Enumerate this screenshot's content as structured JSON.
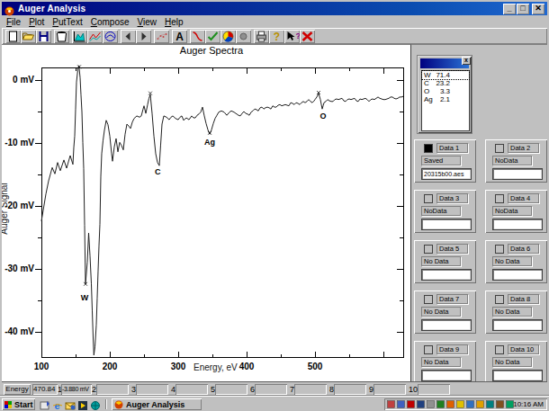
{
  "window": {
    "title": "Auger Analysis"
  },
  "menu": [
    "File",
    "Plot",
    "PutText",
    "Compose",
    "View",
    "Help"
  ],
  "toolbar_icons": [
    "new-document",
    "open-folder",
    "save-disk",
    "bucket",
    "area-chart",
    "line-chart",
    "circle-curve",
    "arrow-left",
    "arrow-right",
    "scatter-points",
    "text-a",
    "red-curve",
    "check-mark",
    "pie-chart",
    "gray-dot",
    "printer",
    "help-question",
    "context-help",
    "close-x"
  ],
  "chart_data": {
    "type": "line",
    "title": "Auger Spectra",
    "xlabel": "Energy, eV",
    "ylabel": "Auger Signal",
    "xlim": [
      100,
      629
    ],
    "ylim": [
      -44.1,
      2
    ],
    "x_ticks_major": [
      100,
      200,
      300,
      400,
      500,
      600
    ],
    "x_ticks_minor": [
      150,
      250,
      350,
      450,
      550
    ],
    "x_tick_labels": [
      "100",
      "200",
      "300",
      "400",
      "500"
    ],
    "y_ticks_major": [
      0,
      -10,
      -20,
      -30,
      -40
    ],
    "y_ticks_minor": [
      -5,
      -15,
      -25,
      -35
    ],
    "y_tick_labels": [
      "0 mV",
      "-10 mV",
      "-20 mV",
      "-30 mV",
      "-40 mV"
    ],
    "annotations": [
      {
        "text": "W",
        "ev": 163,
        "mv": -34.6
      },
      {
        "text": "C",
        "ev": 270,
        "mv": -14.6
      },
      {
        "text": "Ag",
        "ev": 346,
        "mv": -9.8
      },
      {
        "text": "O",
        "ev": 512,
        "mv": -5.7
      }
    ],
    "markers": [
      {
        "ev": 155.3,
        "mv": 2.1
      },
      {
        "ev": 164.5,
        "mv": -32.4
      },
      {
        "ev": 259.2,
        "mv": -2.1
      },
      {
        "ev": 346.1,
        "mv": -8.4
      },
      {
        "ev": 505.3,
        "mv": -2
      }
    ],
    "series": [
      {
        "name": "spectrum",
        "points": [
          [
            100,
            -22.4
          ],
          [
            102.6,
            -20.7
          ],
          [
            106.6,
            -18.1
          ],
          [
            110.5,
            -16
          ],
          [
            115.8,
            -13.9
          ],
          [
            119.7,
            -14.9
          ],
          [
            123.7,
            -13.1
          ],
          [
            127.6,
            -14.4
          ],
          [
            132.9,
            -12.7
          ],
          [
            136.8,
            -14
          ],
          [
            142.1,
            -12
          ],
          [
            146.1,
            -13.4
          ],
          [
            147.4,
            -10.7
          ],
          [
            148.7,
            -8.9
          ],
          [
            150,
            -4.6
          ],
          [
            151.3,
            -0.3
          ],
          [
            153.3,
            1.7
          ],
          [
            154.9,
            2.3
          ],
          [
            156.6,
            0.4
          ],
          [
            157.9,
            -2.4
          ],
          [
            159.2,
            -5
          ],
          [
            160.5,
            -9.9
          ],
          [
            161.8,
            -14.1
          ],
          [
            163.2,
            -23.1
          ],
          [
            164.5,
            -32.4
          ],
          [
            167.1,
            -28.9
          ],
          [
            169.1,
            -24.3
          ],
          [
            171.1,
            -27.9
          ],
          [
            173,
            -32.4
          ],
          [
            174.3,
            -36.7
          ],
          [
            175.7,
            -41
          ],
          [
            176.7,
            -43.7
          ],
          [
            178.3,
            -42.4
          ],
          [
            180.3,
            -38.9
          ],
          [
            181.6,
            -34.6
          ],
          [
            182.9,
            -30.3
          ],
          [
            184.2,
            -26.3
          ],
          [
            185.5,
            -22.9
          ],
          [
            186.8,
            -15.3
          ],
          [
            188.2,
            -11.7
          ],
          [
            190.1,
            -9.6
          ],
          [
            192.1,
            -8
          ],
          [
            194.7,
            -6.4
          ],
          [
            197.4,
            -7.1
          ],
          [
            200,
            -8.9
          ],
          [
            202.6,
            -11.7
          ],
          [
            203.9,
            -12.9
          ],
          [
            206.6,
            -10.6
          ],
          [
            209.2,
            -9.3
          ],
          [
            211.8,
            -11.4
          ],
          [
            214.5,
            -9.9
          ],
          [
            217.1,
            -10.4
          ],
          [
            219.7,
            -11.1
          ],
          [
            222.4,
            -8.6
          ],
          [
            225,
            -7
          ],
          [
            227.6,
            -7.3
          ],
          [
            230.3,
            -7.7
          ],
          [
            232.9,
            -6.7
          ],
          [
            235.5,
            -6.1
          ],
          [
            239.5,
            -5.7
          ],
          [
            243.4,
            -5.9
          ],
          [
            246.1,
            -5.7
          ],
          [
            248.7,
            -4.6
          ],
          [
            250,
            -4.1
          ],
          [
            252.6,
            -5.3
          ],
          [
            255.3,
            -3.9
          ],
          [
            257.2,
            -2.9
          ],
          [
            259.2,
            -2.3
          ],
          [
            261.8,
            -5.3
          ],
          [
            264.5,
            -8.9
          ],
          [
            267.1,
            -11.7
          ],
          [
            269.7,
            -13.1
          ],
          [
            272.4,
            -13.6
          ],
          [
            274.3,
            -10.3
          ],
          [
            276.3,
            -7
          ],
          [
            279,
            -5.7
          ],
          [
            282.9,
            -5.9
          ],
          [
            286.8,
            -6.3
          ],
          [
            289.5,
            -5.9
          ],
          [
            292.1,
            -5.7
          ],
          [
            296.1,
            -6.1
          ],
          [
            300,
            -6.3
          ],
          [
            302.6,
            -5.9
          ],
          [
            305.3,
            -5.7
          ],
          [
            307.9,
            -6.4
          ],
          [
            311.8,
            -6
          ],
          [
            315.8,
            -6.3
          ],
          [
            319.7,
            -5.7
          ],
          [
            322.4,
            -6
          ],
          [
            325,
            -6
          ],
          [
            327.6,
            -5.6
          ],
          [
            330.3,
            -5.4
          ],
          [
            332.9,
            -5.1
          ],
          [
            335.5,
            -4.3
          ],
          [
            338.2,
            -5.7
          ],
          [
            340.8,
            -6.9
          ],
          [
            343.4,
            -7.9
          ],
          [
            346.1,
            -8.6
          ],
          [
            348.7,
            -7.9
          ],
          [
            351.3,
            -6.9
          ],
          [
            353.9,
            -6.1
          ],
          [
            356.6,
            -5.6
          ],
          [
            359.2,
            -5.1
          ],
          [
            363.2,
            -4.9
          ],
          [
            367.1,
            -5.1
          ],
          [
            371.1,
            -5.6
          ],
          [
            375,
            -5.1
          ],
          [
            377.6,
            -4.9
          ],
          [
            381.6,
            -5.1
          ],
          [
            385.5,
            -5.4
          ],
          [
            388.2,
            -5.6
          ],
          [
            390.8,
            -5.7
          ],
          [
            393.4,
            -5.3
          ],
          [
            396.1,
            -5
          ],
          [
            398.7,
            -5.3
          ],
          [
            401.3,
            -5.4
          ],
          [
            403.9,
            -5.6
          ],
          [
            406.6,
            -5.1
          ],
          [
            409.2,
            -4.9
          ],
          [
            411.8,
            -4.6
          ],
          [
            414.5,
            -4.7
          ],
          [
            417.1,
            -4.9
          ],
          [
            419.7,
            -4.4
          ],
          [
            422.4,
            -4.3
          ],
          [
            425,
            -4.6
          ],
          [
            427.6,
            -4.4
          ],
          [
            430.3,
            -4.3
          ],
          [
            432.9,
            -4.4
          ],
          [
            435.5,
            -4.6
          ],
          [
            438.2,
            -4.1
          ],
          [
            440.8,
            -4.3
          ],
          [
            443.4,
            -4.3
          ],
          [
            446.1,
            -4
          ],
          [
            448.7,
            -3.9
          ],
          [
            451.3,
            -4.1
          ],
          [
            454,
            -4
          ],
          [
            456.6,
            -3.9
          ],
          [
            459.2,
            -4
          ],
          [
            461.8,
            -4.1
          ],
          [
            464.5,
            -3.6
          ],
          [
            467.1,
            -3.7
          ],
          [
            469.7,
            -3.9
          ],
          [
            472.4,
            -3.6
          ],
          [
            475,
            -3.7
          ],
          [
            477.6,
            -3.9
          ],
          [
            480.3,
            -3.6
          ],
          [
            482.9,
            -3.4
          ],
          [
            485.5,
            -3.6
          ],
          [
            488.2,
            -3.4
          ],
          [
            490.8,
            -3.1
          ],
          [
            493.4,
            -3.4
          ],
          [
            496.1,
            -3.6
          ],
          [
            498.7,
            -3.3
          ],
          [
            500,
            -3.1
          ],
          [
            502.6,
            -2.7
          ],
          [
            505.3,
            -2.1
          ],
          [
            507.9,
            -3.1
          ],
          [
            510.5,
            -4.6
          ],
          [
            511.8,
            -4.1
          ],
          [
            513.2,
            -3.6
          ],
          [
            515.8,
            -3.4
          ],
          [
            518.4,
            -3.1
          ],
          [
            521.1,
            -3.3
          ],
          [
            523.7,
            -3.4
          ],
          [
            526.3,
            -3.4
          ],
          [
            528.9,
            -3.1
          ],
          [
            531.6,
            -3
          ],
          [
            534.2,
            -3.1
          ],
          [
            536.8,
            -3
          ],
          [
            539.5,
            -2.9
          ],
          [
            542.1,
            -3.3
          ],
          [
            544.7,
            -3.4
          ],
          [
            547.4,
            -3.1
          ],
          [
            550,
            -3
          ],
          [
            552.6,
            -3.1
          ],
          [
            555.3,
            -3
          ],
          [
            557.9,
            -2.9
          ],
          [
            560.5,
            -3.3
          ],
          [
            563.2,
            -3.4
          ],
          [
            565.8,
            -3
          ],
          [
            568.4,
            -3.1
          ],
          [
            571.1,
            -3
          ],
          [
            573.7,
            -2.9
          ],
          [
            576.3,
            -3.1
          ],
          [
            578.9,
            -3.4
          ],
          [
            581.6,
            -3.1
          ],
          [
            584.2,
            -3
          ],
          [
            586.8,
            -3.1
          ],
          [
            589.5,
            -2.9
          ],
          [
            592.1,
            -2.7
          ],
          [
            594.7,
            -2.9
          ],
          [
            597.4,
            -3
          ],
          [
            600,
            -3.1
          ],
          [
            602.6,
            -3.1
          ],
          [
            605.3,
            -3
          ],
          [
            607.9,
            -2.9
          ],
          [
            610.5,
            -2.7
          ],
          [
            613.2,
            -2.7
          ],
          [
            615.8,
            -2.9
          ],
          [
            618.4,
            -3
          ],
          [
            621.1,
            -2.9
          ],
          [
            623.7,
            -2.7
          ],
          [
            626.3,
            -2.7
          ],
          [
            628.9,
            -2.6
          ]
        ]
      }
    ]
  },
  "results_window": {
    "rows": [
      {
        "element": "W",
        "value": "71.4"
      },
      {
        "element": "C",
        "value": "23.2"
      },
      {
        "element": "O",
        "value": "3.3"
      },
      {
        "element": "Ag",
        "value": "2.1"
      }
    ]
  },
  "data_slots": [
    {
      "label": "Data 1",
      "status": "Saved",
      "file": "20315b00.aes",
      "selected": true
    },
    {
      "label": "Data 2",
      "status": "NoData",
      "file": "",
      "selected": false
    },
    {
      "label": "Data 3",
      "status": "NoData",
      "file": "",
      "selected": false
    },
    {
      "label": "Data 4",
      "status": "NoData",
      "file": "",
      "selected": false
    },
    {
      "label": "Data 5",
      "status": "No Data",
      "file": "",
      "selected": false
    },
    {
      "label": "Data 6",
      "status": "No Data",
      "file": "",
      "selected": false
    },
    {
      "label": "Data 7",
      "status": "No Data",
      "file": "",
      "selected": false
    },
    {
      "label": "Data 8",
      "status": "No Data",
      "file": "",
      "selected": false
    },
    {
      "label": "Data 9",
      "status": "No Data",
      "file": "",
      "selected": false
    },
    {
      "label": "Data 10",
      "status": "No Data",
      "file": "",
      "selected": false
    }
  ],
  "status_bar": {
    "energy_label": "Energy",
    "energy_value": "470.84",
    "channels": [
      {
        "n": "1",
        "value": "-3.880 mV"
      },
      {
        "n": "2",
        "value": ""
      },
      {
        "n": "3",
        "value": ""
      },
      {
        "n": "4",
        "value": ""
      },
      {
        "n": "5",
        "value": ""
      },
      {
        "n": "6",
        "value": ""
      },
      {
        "n": "7",
        "value": ""
      },
      {
        "n": "8",
        "value": ""
      },
      {
        "n": "9",
        "value": ""
      },
      {
        "n": "10",
        "value": ""
      }
    ]
  },
  "taskbar": {
    "start_label": "Start",
    "task_label": "Auger Analysis",
    "time": "10:16 AM",
    "quicklaunch_icons": [
      "show-desktop",
      "internet-explorer",
      "outlook",
      "media-player",
      "channels"
    ],
    "tray_icon_count": 13
  }
}
